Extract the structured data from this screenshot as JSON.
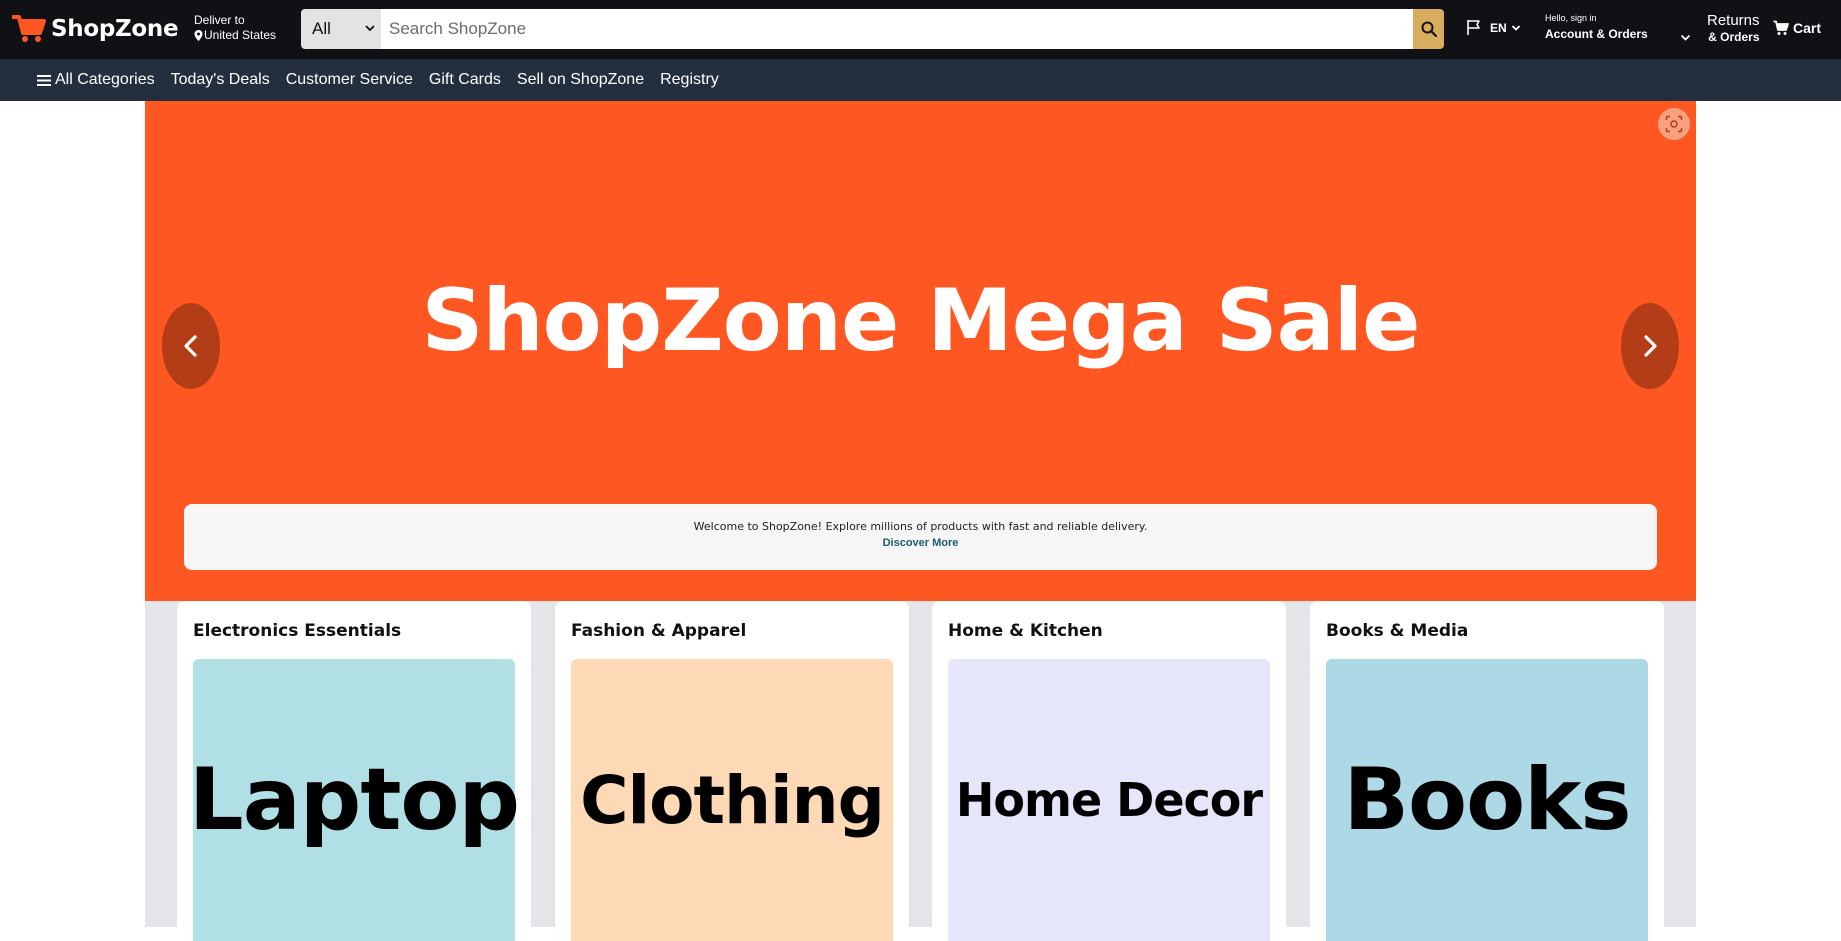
{
  "header": {
    "logo_text": "ShopZone",
    "deliver_label": "Deliver to",
    "deliver_location": "United States",
    "search_category": "All",
    "search_placeholder": "Search ShopZone",
    "language": "EN",
    "greeting": "Hello, sign in",
    "account_label": "Account & Orders",
    "returns_label": "Returns",
    "orders_label": "& Orders",
    "cart_label": "Cart"
  },
  "nav": {
    "items": [
      "All Categories",
      "Today's Deals",
      "Customer Service",
      "Gift Cards",
      "Sell on ShopZone",
      "Registry"
    ]
  },
  "hero": {
    "title": "ShopZone Mega Sale",
    "welcome_message": "Welcome to ShopZone! Explore millions of products with fast and reliable delivery.",
    "discover_link": "Discover More"
  },
  "categories": [
    {
      "title": "Electronics Essentials",
      "tile_label": "Laptop",
      "tile_color": "#b0e0e6"
    },
    {
      "title": "Fashion & Apparel",
      "tile_label": "Clothing",
      "tile_color": "#fdd9b5"
    },
    {
      "title": "Home & Kitchen",
      "tile_label": "Home Decor",
      "tile_color": "#e6e6fa"
    },
    {
      "title": "Books & Media",
      "tile_label": "Books",
      "tile_color": "#add8e6"
    }
  ],
  "colors": {
    "header_bg": "#0f1114",
    "nav_bg": "#232f3e",
    "accent": "#ff5722",
    "search_button": "#d9ad5f"
  },
  "icons": {
    "logo": "shopping-cart-icon",
    "location": "location-pin-icon",
    "search": "search-icon",
    "language": "flag-icon",
    "cart": "cart-icon",
    "menu": "hamburger-menu-icon",
    "prev": "chevron-left-icon",
    "next": "chevron-right-icon",
    "lens": "camera-lens-icon"
  }
}
